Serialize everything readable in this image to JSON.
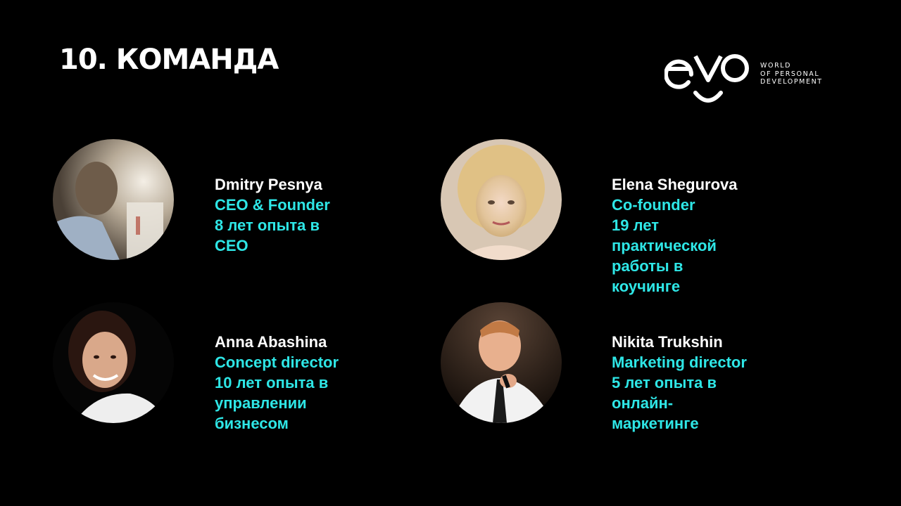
{
  "slide": {
    "title": "10. КОМАНДА"
  },
  "logo": {
    "tagline_lines": [
      "WORLD",
      "OF PERSONAL",
      "DEVELOPMENT"
    ]
  },
  "colors": {
    "background": "#000000",
    "title": "#ffffff",
    "name": "#ffffff",
    "accent": "#2ee6e6"
  },
  "team": [
    {
      "name": "Dmitry Pesnya",
      "role": "CEO & Founder",
      "experience": "8 лет опыта в CEO",
      "photo_icon": "person-photo-icon"
    },
    {
      "name": "Elena Shegurova",
      "role": "Co-founder",
      "experience": "19 лет практической\nработы в коучинге",
      "photo_icon": "person-photo-icon"
    },
    {
      "name": "Anna Abashina",
      "role": "Concept director",
      "experience": "10 лет опыта в\nуправлении бизнесом",
      "photo_icon": "person-photo-icon"
    },
    {
      "name": "Nikita Trukshin",
      "role": "Marketing director",
      "experience": "5 лет опыта в онлайн-\nмаркетинге",
      "photo_icon": "person-photo-icon"
    }
  ]
}
